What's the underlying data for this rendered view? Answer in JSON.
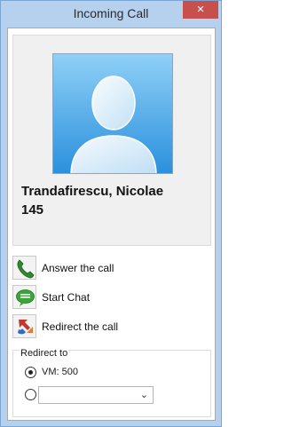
{
  "window": {
    "title": "Incoming Call",
    "close_glyph": "×"
  },
  "caller": {
    "name": "Trandafirescu, Nicolae",
    "number": "145",
    "avatar_icon": "person-silhouette-icon"
  },
  "actions": [
    {
      "label": "Answer the call",
      "icon": "phone-handset-icon",
      "color": "#2f8a2f"
    },
    {
      "label": "Start Chat",
      "icon": "chat-bubble-icon",
      "color": "#3aa63a"
    },
    {
      "label": "Redirect the call",
      "icon": "redirect-arrows-icon",
      "color": "#c0392b"
    }
  ],
  "redirect": {
    "group_label": "Redirect to",
    "options": [
      {
        "label": "VM: 500",
        "selected": true
      },
      {
        "label": "",
        "selected": false
      }
    ],
    "combo_value": ""
  },
  "colors": {
    "titlebar": "#b6d1ee",
    "close_button": "#c7504c",
    "avatar_bg": "#4ba6e6"
  }
}
